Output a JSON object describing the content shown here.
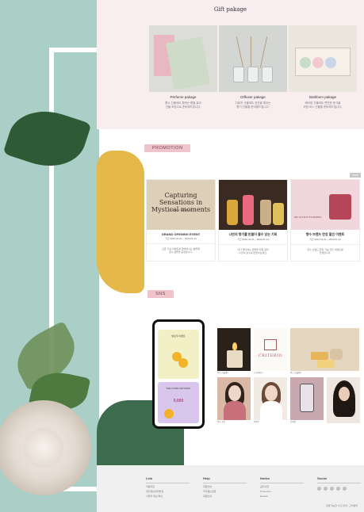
{
  "gift": {
    "title": "Gift pakage",
    "cards": [
      {
        "label": "Perfume pakage",
        "desc1": "향수 선물세트 원하는 향을 골라",
        "desc2": "선물 포장으로 준비해드립니다."
      },
      {
        "label": "Diffuser pakage",
        "desc1": "디퓨저 선물세트 공간을 채우는",
        "desc2": "향기 선물을 준비해드립니다."
      },
      {
        "label": "Bathbom pakage",
        "desc1": "배쓰밤 선물세트 편안한 휴식을",
        "desc2": "위한 바스 선물을 준비해드립니다."
      }
    ]
  },
  "promotion": {
    "heading": "PROMOTION",
    "more": "more",
    "cards": [
      {
        "img_caption": "Capturing Sensations in Mystical moments",
        "img_sub": "Perfume Exhibition",
        "title": "GRAND OPENING EVENT",
        "date": "기간 2024.01.01 ~ 2024.01.31",
        "desc1": "오픈 기념 이벤트를 참여하시는 분들께",
        "desc2": "향수 샘플을 증정합니다."
      },
      {
        "title": "나만의 향기를 만들어 볼수 있는 기회",
        "date": "기간 2024.01.01 ~ 2024.01.31",
        "desc1": "내가 좋아하는 향들을 직접 골라",
        "desc2": "나만의 향수를 만들어보세요."
      },
      {
        "img_caption": "MY LITTLE FLOWERS",
        "title": "향수 브랜드 런칭 할인 이벤트",
        "date": "기간 2024.01.01 ~ 2024.01.31",
        "desc1": "향수 브랜드 런칭 기념 할인 이벤트를",
        "desc2": "진행합니다."
      }
    ]
  },
  "sns": {
    "heading": "SNS",
    "phone_msg1": "팔로우 이벤트",
    "phone_msg2": "WELCOME CRITERIO",
    "phone_price": "9,000",
    "logo_name": "CRITERIO",
    "captions": [
      "향수 선물세트",
      "크리테리오",
      "바스 선물세트",
      "향수 추천",
      "이벤트",
      "신제품"
    ]
  },
  "footer": {
    "columns": [
      {
        "heading": "Link",
        "items": [
          "이용약관",
          "개인정보처리방침",
          "사업자 정보 확인"
        ]
      },
      {
        "heading": "Help",
        "items": [
          "회원안내",
          "자주묻는질문",
          "회원안내"
        ]
      },
      {
        "heading": "Notice",
        "items": [
          "공지사항",
          "Promotion",
          "Review"
        ]
      },
      {
        "heading": "Social",
        "items": []
      }
    ],
    "note": "상담가능한 시간 안내 / 고객센터"
  },
  "colors": {
    "mint": "#a9cfc6",
    "pink_bg": "#f8eef0",
    "tag_pink": "#efc5cb",
    "green": "#3d6b4d",
    "mustard": "#e4b94a"
  }
}
